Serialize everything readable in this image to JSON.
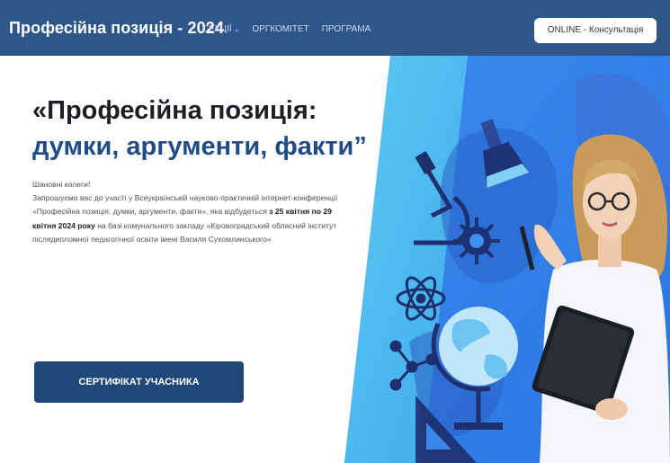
{
  "header": {
    "brand": "Професійна позиція - 2024",
    "nav": [
      {
        "label": "СЕКЦІЇ",
        "has_dropdown": true
      },
      {
        "label": "ОРГКОМІТЕТ",
        "has_dropdown": false
      },
      {
        "label": "ПРОГРАМА",
        "has_dropdown": false
      }
    ],
    "cta": "ONLINE - Консультація"
  },
  "hero": {
    "headline_line1": "«Професійна позиція:",
    "headline_line2": "думки, аргументи, факти”",
    "greeting": "Шановні колеги!",
    "text_1": "Запрошуємо вас до участі у Всеукраїнській науково-практичній інтернет-конференції «Професійна позиція: думки, аргументи, факти», яка відбудеться ",
    "text_dates": "з 25 квітня по 29 квітня 2024 року",
    "text_2": " на базі комунального закладу «Кіровоградський обласний інститут післядипломної педагогічної освіти імені Василя Сухомлинського»",
    "button": "СЕРТИФІКАТ УЧАСНИКА"
  },
  "colors": {
    "header_bg": "#2f5689",
    "accent_blue": "#1f4c86",
    "button_bg": "#1f4878",
    "art_blue": "#2f7fe5",
    "art_cyan": "#52c2ef"
  }
}
